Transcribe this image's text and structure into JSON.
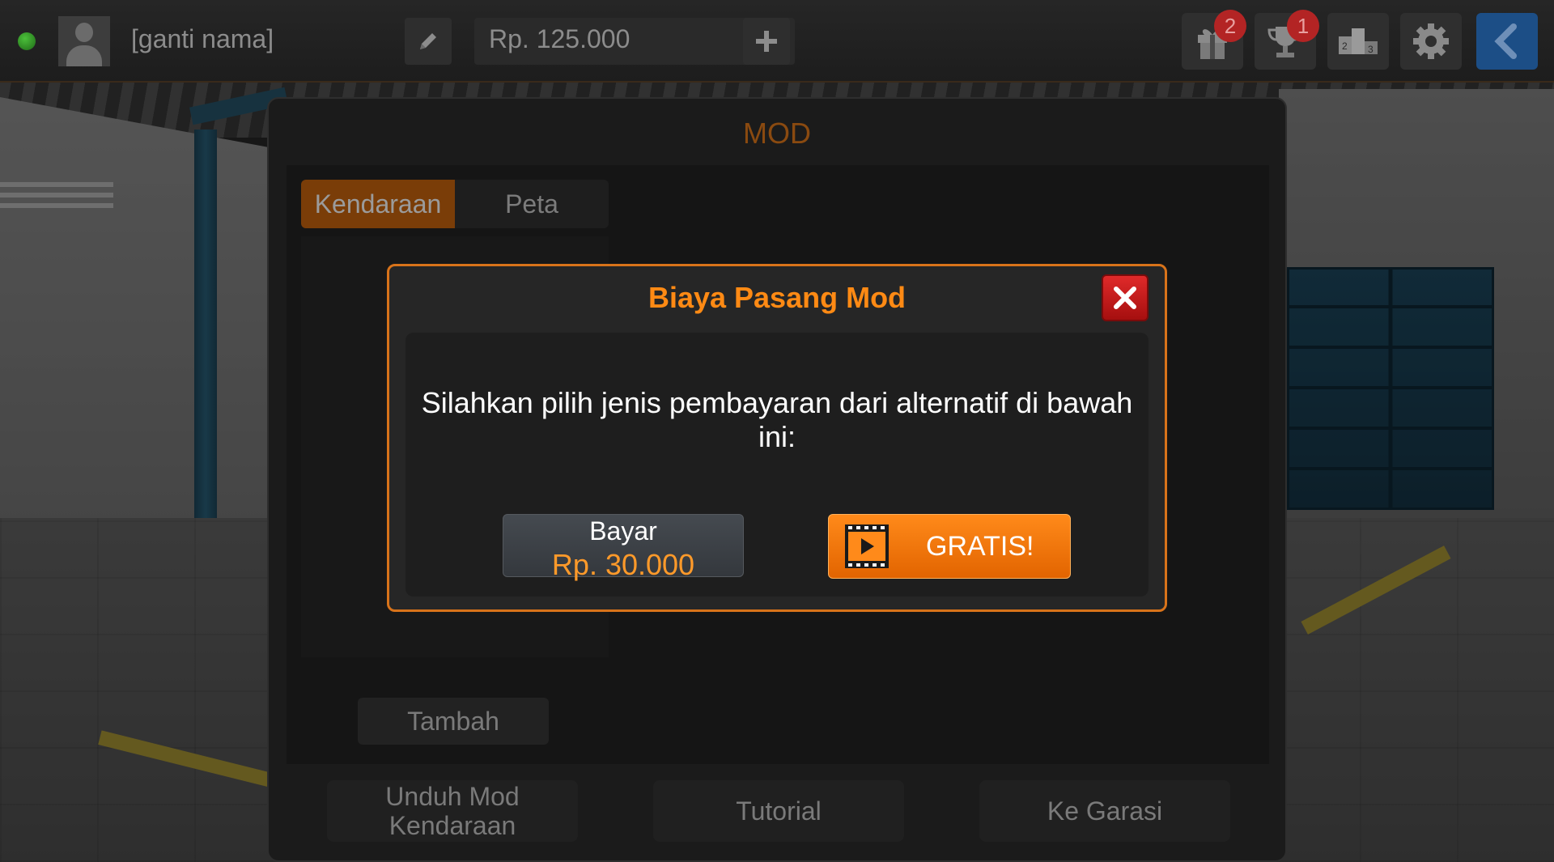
{
  "topbar": {
    "player_name": "[ganti nama]",
    "money": "Rp. 125.000",
    "gift_badge": "2",
    "trophy_badge": "1"
  },
  "mod_panel": {
    "title": "MOD",
    "tabs": [
      {
        "label": "Kendaraan",
        "active": true
      },
      {
        "label": "Peta",
        "active": false
      }
    ],
    "tambah_label": "Tambah",
    "bottom_buttons": [
      "Unduh Mod Kendaraan",
      "Tutorial",
      "Ke Garasi"
    ]
  },
  "dialog": {
    "title": "Biaya Pasang Mod",
    "message": "Silahkan pilih jenis pembayaran dari alternatif di bawah ini:",
    "pay": {
      "label": "Bayar",
      "price": "Rp. 30.000"
    },
    "free": {
      "label": "GRATIS!",
      "icon": "video-ad-icon"
    }
  },
  "colors": {
    "accent_orange": "#ff8a14",
    "close_red": "#d01c1c",
    "back_blue": "#1c4e86",
    "status_green": "#3ca02e"
  }
}
